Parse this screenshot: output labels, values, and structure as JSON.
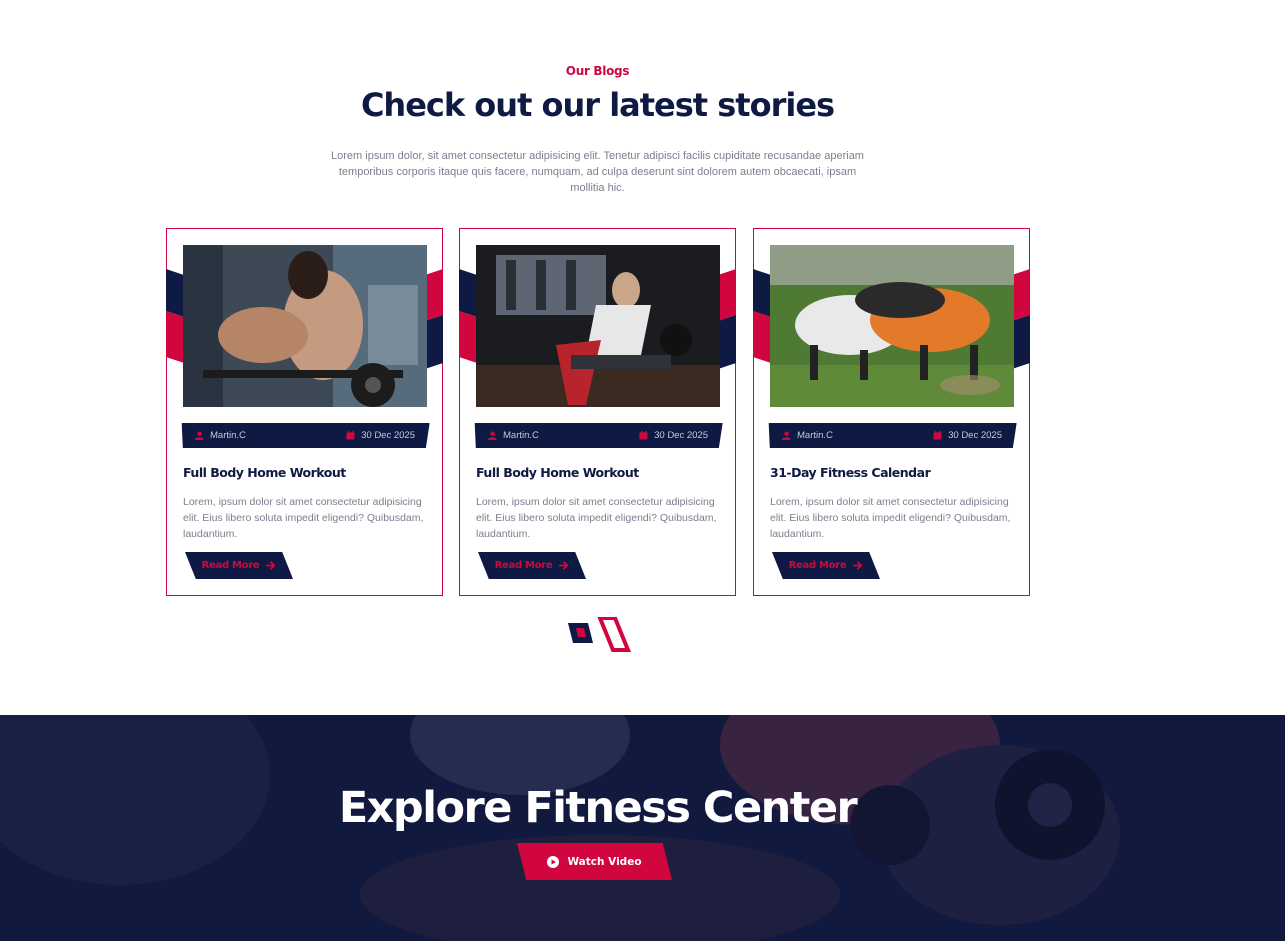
{
  "section": {
    "eyebrow": "Our Blogs",
    "heading": "Check out our latest stories",
    "intro": "Lorem ipsum dolor, sit amet consectetur adipisicing elit. Tenetur adipisci facilis cupiditate recusandae aperiam temporibus corporis itaque quis facere, numquam, ad culpa deserunt sint dolorem autem obcaecati, ipsam mollitia hic."
  },
  "posts": [
    {
      "author": "Martin.C",
      "date": "30 Dec 2025",
      "title": "Full Body Home Workout",
      "excerpt": "Lorem, ipsum dolor sit amet consectetur adipisicing elit. Eius libero soluta impedit eligendi? Quibusdam, laudantium.",
      "cta": "Read More"
    },
    {
      "author": "Martin.C",
      "date": "30 Dec 2025",
      "title": "Full Body Home Workout",
      "excerpt": "Lorem, ipsum dolor sit amet consectetur adipisicing elit. Eius libero soluta impedit eligendi? Quibusdam, laudantium.",
      "cta": "Read More"
    },
    {
      "author": "Martin.C",
      "date": "30 Dec 2025",
      "title": "31-Day Fitness Calendar",
      "excerpt": "Lorem, ipsum dolor sit amet consectetur adipisicing elit. Eius libero soluta impedit eligendi? Quibusdam, laudantium.",
      "cta": "Read More"
    }
  ],
  "pagination": {
    "pages": 2,
    "active": 2
  },
  "hero": {
    "title": "Explore Fitness Center",
    "button": "Watch Video"
  },
  "icons": {
    "author": "user-icon",
    "date": "calendar-icon",
    "cta": "arrow-right-icon",
    "play": "play-circle-icon"
  },
  "colors": {
    "primary": "#d1063f",
    "navy": "#0e1a44",
    "text_muted": "#7b7f8e"
  }
}
